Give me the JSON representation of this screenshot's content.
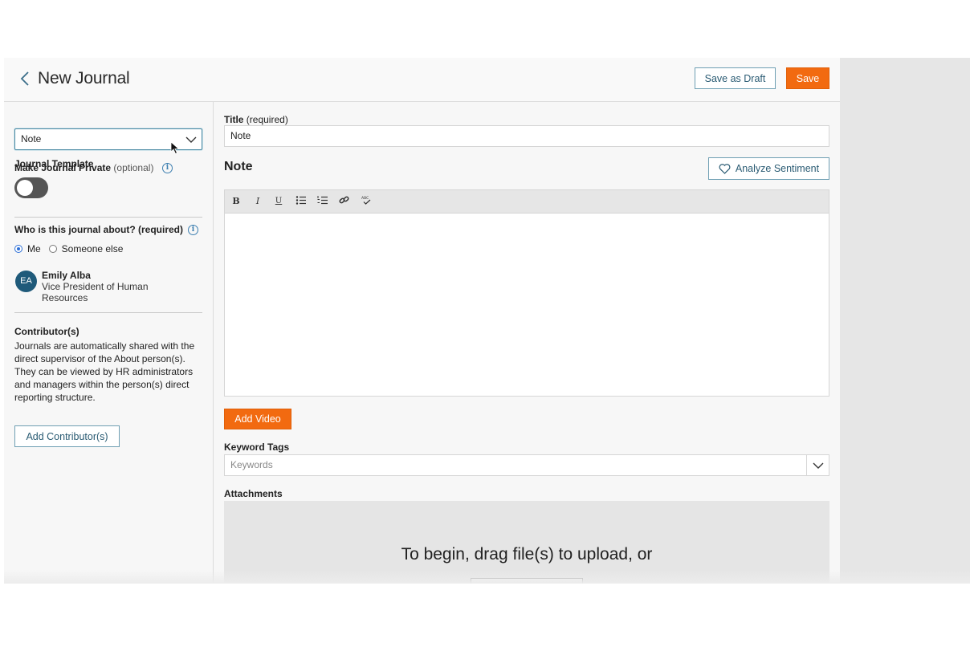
{
  "header": {
    "title": "New Journal",
    "save_draft_label": "Save as Draft",
    "save_label": "Save"
  },
  "sidebar": {
    "template_label": "Journal Template",
    "template_value": "Note",
    "private_label": "Make Journal Private",
    "private_optional": "(optional)",
    "private_on": false,
    "about_label": "Who is this journal about? (required)",
    "about_options": [
      {
        "label": "Me",
        "selected": true
      },
      {
        "label": "Someone else",
        "selected": false
      }
    ],
    "person": {
      "initials": "EA",
      "name": "Emily Alba",
      "role": "Vice President of Human Resources"
    },
    "contributors_label": "Contributor(s)",
    "contributors_text": "Journals are automatically shared with the direct supervisor of the About person(s). They can be viewed by HR administrators and managers within the person(s) direct reporting structure.",
    "add_contributors_label": "Add Contributor(s)"
  },
  "main": {
    "title_label": "Title",
    "title_required": "(required)",
    "title_value": "Note",
    "section_heading": "Note",
    "analyze_label": "Analyze Sentiment",
    "toolbar": [
      "B",
      "I",
      "U",
      "bulleted-list",
      "numbered-list",
      "link",
      "spellcheck"
    ],
    "add_video_label": "Add Video",
    "keywords_label": "Keyword Tags",
    "keywords_placeholder": "Keywords",
    "attachments_label": "Attachments",
    "dropzone_text": "To begin, drag file(s) to upload, or"
  },
  "colors": {
    "accent_orange": "#f26a10",
    "outline_blue": "#6f9fb3",
    "avatar_blue": "#1f5a7a",
    "radio_blue": "#2d6fd6"
  },
  "icons": [
    "back-chevron-icon",
    "chevron-down-icon",
    "info-icon",
    "heart-icon",
    "bold-icon",
    "italic-icon",
    "underline-icon",
    "bulleted-list-icon",
    "numbered-list-icon",
    "link-icon",
    "spellcheck-icon",
    "mouse-cursor-icon"
  ]
}
